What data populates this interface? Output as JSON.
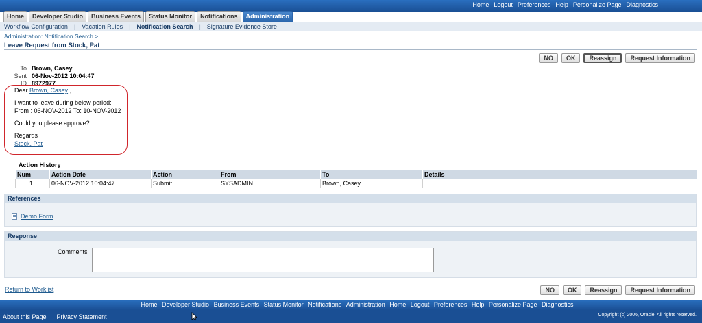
{
  "global_links": [
    "Home",
    "Logout",
    "Preferences",
    "Help",
    "Personalize Page",
    "Diagnostics"
  ],
  "tabs": [
    {
      "label": "Home",
      "active": false
    },
    {
      "label": "Developer Studio",
      "active": false
    },
    {
      "label": "Business Events",
      "active": false
    },
    {
      "label": "Status Monitor",
      "active": false
    },
    {
      "label": "Notifications",
      "active": false
    },
    {
      "label": "Administration",
      "active": true
    }
  ],
  "subtabs": [
    {
      "label": "Workflow Configuration",
      "active": false
    },
    {
      "label": "Vacation Rules",
      "active": false
    },
    {
      "label": "Notification Search",
      "active": true
    },
    {
      "label": "Signature Evidence Store",
      "active": false
    }
  ],
  "breadcrumb": "Administration: Notification Search  >",
  "page_title": "Leave Request from Stock, Pat",
  "action_buttons": {
    "no": "NO",
    "ok": "OK",
    "reassign": "Reassign",
    "request_info": "Request Information"
  },
  "header": {
    "to_label": "To",
    "to_value": "Brown, Casey",
    "sent_label": "Sent",
    "sent_value": "06-Nov-2012 10:04:47",
    "id_label": "ID",
    "id_value": "8972977"
  },
  "message": {
    "dear_prefix": "Dear",
    "recipient_link": "Brown, Casey",
    "dear_suffix": ",",
    "line1": "I want to leave during below period:",
    "line2": "From : 06-NOV-2012 To: 10-NOV-2012",
    "line3": "Could you please approve?",
    "regards": "Regards",
    "sender_link": "Stock, Pat"
  },
  "action_history": {
    "title": "Action History",
    "columns": [
      "Num",
      "Action Date",
      "Action",
      "From",
      "To",
      "Details"
    ],
    "rows": [
      [
        "1",
        "06-NOV-2012 10:04:47",
        "Submit",
        "SYSADMIN",
        "Brown, Casey",
        ""
      ]
    ]
  },
  "references": {
    "title": "References",
    "link": "Demo Form"
  },
  "response": {
    "title": "Response",
    "comments_label": "Comments",
    "comments_value": ""
  },
  "return_link": "Return to Worklist",
  "footer_links": [
    "Home",
    "Developer Studio",
    "Business Events",
    "Status Monitor",
    "Notifications",
    "Administration",
    "Home",
    "Logout",
    "Preferences",
    "Help",
    "Personalize Page",
    "Diagnostics"
  ],
  "about_link": "About this Page",
  "privacy_link": "Privacy Statement",
  "copyright": "Copyright (c) 2006, Oracle.  All rights reserved.",
  "colors": {
    "brand_blue": "#1e5fa8",
    "annotation_red": "#d0262c"
  }
}
